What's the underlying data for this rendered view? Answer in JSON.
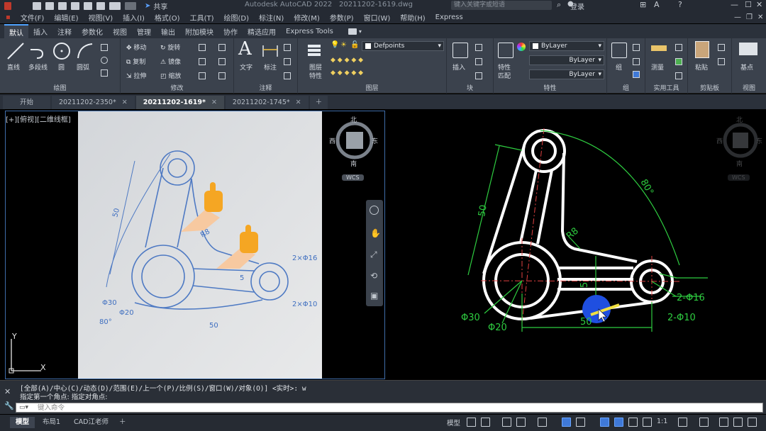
{
  "titlebar": {
    "app_title": "Autodesk AutoCAD 2022",
    "file_name": "20211202-1619.dwg",
    "share_label": "共享",
    "search_placeholder": "键入关键字或短语",
    "login_label": "登录"
  },
  "menu": [
    "文件(F)",
    "编辑(E)",
    "视图(V)",
    "插入(I)",
    "格式(O)",
    "工具(T)",
    "绘图(D)",
    "标注(N)",
    "修改(M)",
    "参数(P)",
    "窗口(W)",
    "帮助(H)",
    "Express"
  ],
  "ribbon_tabs": [
    "默认",
    "插入",
    "注释",
    "参数化",
    "视图",
    "管理",
    "输出",
    "附加模块",
    "协作",
    "精选应用",
    "Express Tools"
  ],
  "ribbon": {
    "draw": {
      "line": "直线",
      "polyline": "多段线",
      "circle": "圆",
      "arc": "圆弧",
      "label": "绘图"
    },
    "modify": {
      "move": "移动",
      "rotate": "旋转",
      "copy": "复制",
      "mirror": "镜像",
      "stretch": "拉伸",
      "scale": "缩放",
      "label": "修改"
    },
    "annotation": {
      "text": "文字",
      "dimension": "标注",
      "label": "注释"
    },
    "layers": {
      "layer_props": "图层",
      "layer_props2": "特性",
      "current_layer": "Defpoints",
      "label": "图层"
    },
    "block": {
      "insert": "插入",
      "label": "块"
    },
    "properties": {
      "match": "特性",
      "match2": "匹配",
      "color": "ByLayer",
      "linetype": "ByLayer",
      "lineweight": "ByLayer",
      "label": "特性"
    },
    "groups": {
      "group": "组",
      "label": "组"
    },
    "utilities": {
      "measure": "测量",
      "label": "实用工具"
    },
    "clipboard": {
      "paste": "粘贴",
      "label": "剪贴板"
    },
    "view": {
      "base": "基点",
      "label": "视图"
    }
  },
  "file_tabs": [
    {
      "label": "开始",
      "active": false
    },
    {
      "label": "20211202-2350*",
      "active": false
    },
    {
      "label": "20211202-1619*",
      "active": true
    },
    {
      "label": "20211202-1745*",
      "active": false
    }
  ],
  "viewport_label": "[+][俯视][二维线框]",
  "viewcube": {
    "north": "北",
    "south": "南",
    "east": "东",
    "west": "西",
    "wcs": "WCS"
  },
  "drawing": {
    "dim_50_vertical": "50",
    "dim_80deg": "80°",
    "dim_r8": "R8",
    "dim_5": "5",
    "dim_2xphi16": "2-Φ16",
    "dim_2xphi10": "2-Φ10",
    "dim_phi30": "Φ30",
    "dim_phi20": "Φ20",
    "dim_50_horizontal": "50"
  },
  "photo_labels": {
    "p50v": "50",
    "pr8": "R8",
    "p5": "5",
    "p2phi16": "2×Φ16",
    "p2phi10": "2×Φ10",
    "pphi30": "Φ30",
    "pphi20": "Φ20",
    "p80": "80°",
    "p50h": "50"
  },
  "ucs": {
    "x": "X",
    "y": "Y"
  },
  "command": {
    "history1": "[全部(A)/中心(C)/动态(D)/范围(E)/上一个(P)/比例(S)/窗口(W)/对象(O)] <实时>: w",
    "history2": "指定第一个角点: 指定对角点:",
    "input_placeholder": "键入命令"
  },
  "status_tabs": [
    {
      "label": "模型",
      "active": true
    },
    {
      "label": "布局1",
      "active": false
    },
    {
      "label": "CAD江老师",
      "active": false
    }
  ],
  "status_right": {
    "model": "模型",
    "scale": "1:1"
  },
  "colors": {
    "accent": "#3f79d8",
    "dimension": "#2ecc40",
    "centerline": "#e04040",
    "highlight": "#1f4fe0"
  }
}
